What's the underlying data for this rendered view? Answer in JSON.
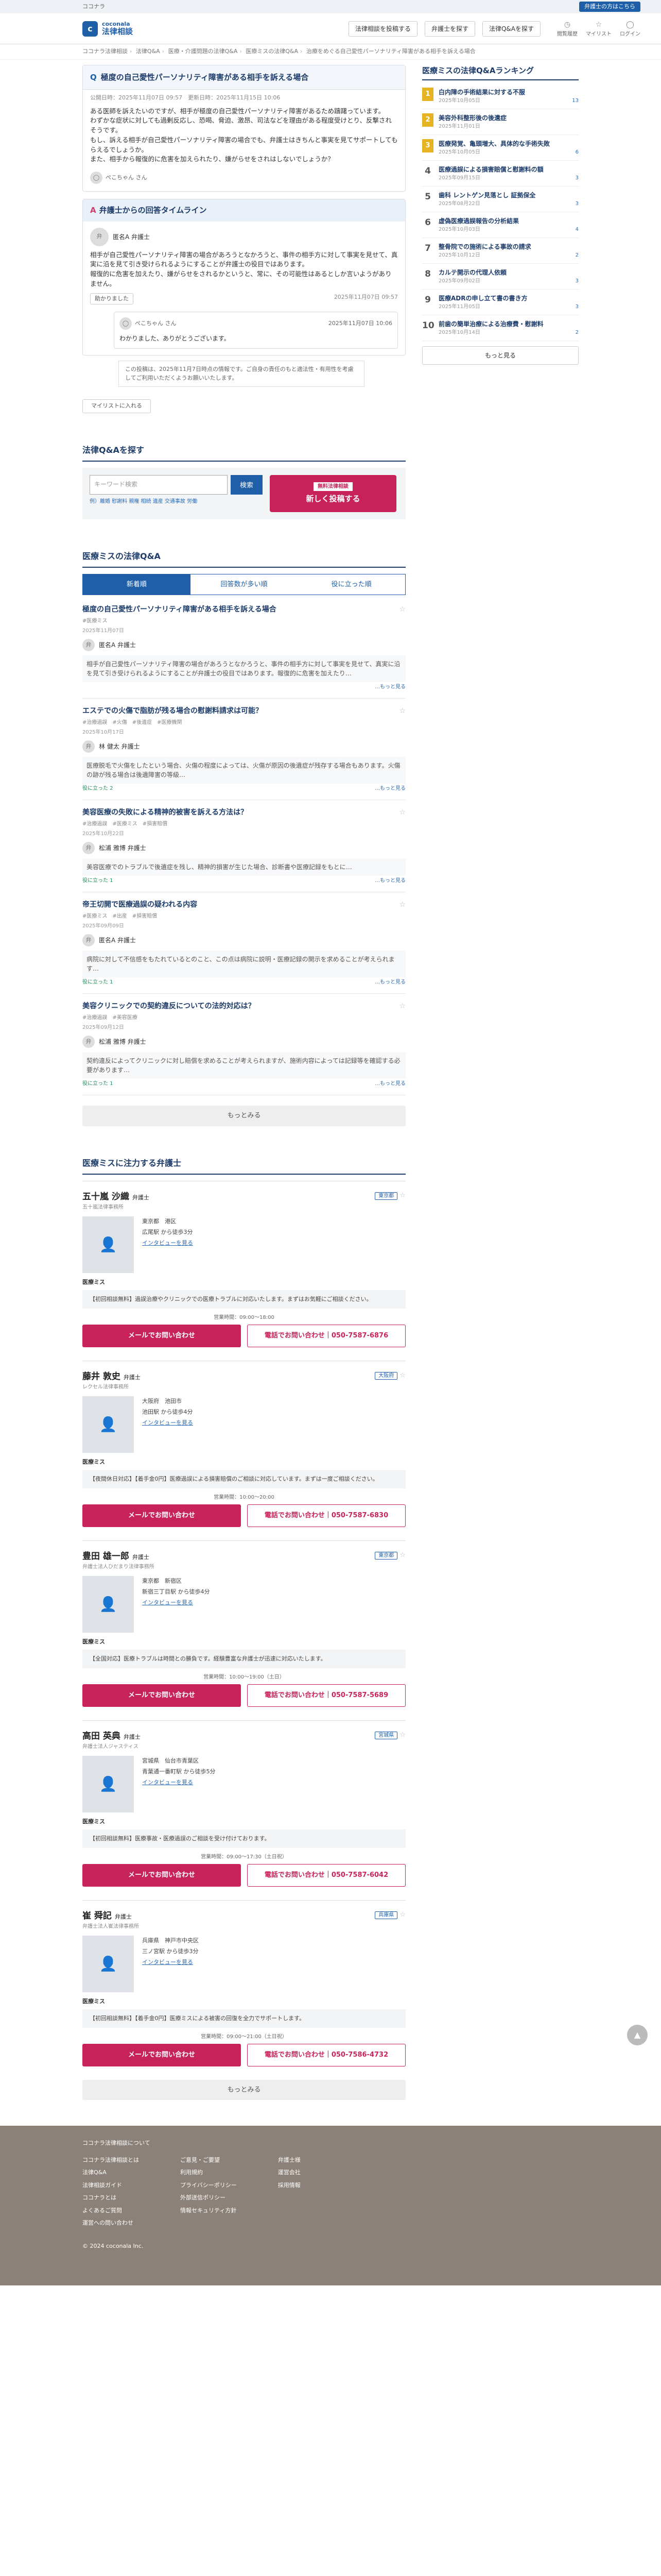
{
  "topline": {
    "tagline": "ココナラ",
    "login": "弁護士の方はこちら"
  },
  "header": {
    "logo_a": "coconala",
    "logo_b": "法律相談",
    "post": "法律相談を投稿する",
    "find": "弁護士を探す",
    "qa": "法律Q&Aを探す",
    "icons": [
      "閲覧履歴",
      "マイリスト",
      "ログイン"
    ]
  },
  "breadcrumb": [
    "ココナラ法律相談",
    "法律Q&A",
    "医療・介護問題の法律Q&A",
    "医療ミスの法律Q&A",
    "治療をめぐる自己愛性パーソナリティ障害がある相手を訴える場合"
  ],
  "question": {
    "title": "極度の自己愛性パーソナリティ障害がある相手を訴える場合",
    "meta": "公開日時：2025年11月07日 09:57　更新日時：2025年11月15日 10:06",
    "body": "ある医師を訴えたいのですが、相手が極度の自己愛性パーソナリティ障害があるため躊躇っています。\nわずかな症状に対しても過剰反応し、恐喝、脅迫、激昂、司法などを理由がある程度受けとり、反撃されそうです。\nもし、訴える相手が自己愛性パーソナリティ障害の場合でも、弁護士はきちんと事実を見てサポートしてもらえるでしょうか。\nまた、相手から報復的に危害を加えられたり、嫌がらせをされはしないでしょうか？",
    "user": "ぺこちゃん さん"
  },
  "answers": {
    "title": "弁護士からの回答タイムライン",
    "lawyer": "匿名A 弁護士",
    "body": "相手が自己愛性パーソナリティ障害の場合があろうとなかろうと、事件の相手方に対して事実を見せて、真実に沿を見て引き受けられるようにすることが弁護士の役目ではあります。\n報復的に危害を加えたり、嫌がらせをされるかというと、常に、その可能性はあるとしか言いようがありません。",
    "thanks": "助かりました",
    "date": "2025年11月07日 09:57",
    "reply_user": "ぺこちゃん さん",
    "reply_date": "2025年11月07日 10:06",
    "reply": "わかりました、ありがとうございます。"
  },
  "note": "この投稿は、2025年11月7日時点の情報です。ご自身の責任のもと適法性・有用性を考慮してご利用いただくようお願いいたします。",
  "mylist": "マイリストに入れる",
  "search": {
    "title": "法律Q&Aを探す",
    "placeholder": "キーワード検索",
    "button": "検索",
    "tags": "例）離婚 慰謝料 親権 相続 遺産 交通事故 労働",
    "post_small": "無料法律相談",
    "post": "新しく投稿する"
  },
  "qa_list": {
    "title": "医療ミスの法律Q&A",
    "tabs": [
      "新着順",
      "回答数が多い順",
      "役に立った順"
    ],
    "items": [
      {
        "title": "極度の自己愛性パーソナリティ障害がある相手を訴える場合",
        "tags": "#医療ミス",
        "date": "2025年11月07日",
        "lawyer": "匿名A 弁護士",
        "excerpt": "相手が自己愛性パーソナリティ障害の場合があろうとなかろうと、事件の相手方に対して事実を見せて、真実に沿を見て引き受けられるようにすることが弁護士の役目ではあります。報復的に危害を加えたり…",
        "helpful": "",
        "more": "…もっと見る"
      },
      {
        "title": "エステでの火傷で脂肪が残る場合の慰謝料請求は可能？",
        "tags": "#治療過誤　#火傷　#後遺症　#医療機関",
        "date": "2025年10月17日",
        "lawyer": "林 健太 弁護士",
        "excerpt": "医療脱毛で火傷をしたという場合、火傷の程度によっては、火傷が原因の後遺症が残存する場合もあります。火傷の跡が残る場合は後遺障害の等級…",
        "helpful": "役に立った 2",
        "more": "…もっと見る"
      },
      {
        "title": "美容医療の失敗による精神的被害を訴える方法は？",
        "tags": "#治療過誤　#医療ミス　#損害賠償",
        "date": "2025年10月22日",
        "lawyer": "松浦 雅博 弁護士",
        "excerpt": "美容医療でのトラブルで後遺症を残し、精神的損害が生じた場合、診断書や医療記録をもとに…",
        "helpful": "役に立った 1",
        "more": "…もっと見る"
      },
      {
        "title": "帝王切開で医療過誤の疑われる内容",
        "tags": "#医療ミス　#出産　#損害賠償",
        "date": "2025年09月09日",
        "lawyer": "匿名A 弁護士",
        "excerpt": "病院に対して不信感をもたれているとのこと、この点は病院に説明・医療記録の開示を求めることが考えられます…",
        "helpful": "役に立った 1",
        "more": "…もっと見る"
      },
      {
        "title": "美容クリニックでの契約違反についての法的対応は？",
        "tags": "#治療過誤　#美容医療",
        "date": "2025年09月12日",
        "lawyer": "松浦 雅博 弁護士",
        "excerpt": "契約違反によってクリニックに対し賠償を求めることが考えられますが、施術内容によっては記録等を確認する必要があります…",
        "helpful": "役に立った 1",
        "more": "…もっと見る"
      }
    ],
    "more": "もっとみる"
  },
  "lawyers": {
    "title": "医療ミスに注力する弁護士",
    "items": [
      {
        "name": "五十嵐 沙織",
        "suffix": "弁護士",
        "firm": "五十嵐法律事務所",
        "pref": "東京都",
        "area": "東京都　港区",
        "station": "広尾駅 から徒歩3分",
        "link": "インタビューを見る",
        "spec": "医療ミス",
        "desc": "【初回相談無料】過誤治療やクリニックでの医療トラブルに対応いたします。まずはお気軽にご相談ください。",
        "hours": "営業時間：09:00〜18:00",
        "mail": "メールでお問い合わせ",
        "tel": "電話でお問い合わせ｜050-7587-6876"
      },
      {
        "name": "藤井 敦史",
        "suffix": "弁護士",
        "firm": "レクセル法律事務所",
        "pref": "大阪府",
        "area": "大阪府　池田市",
        "station": "池田駅 から徒歩4分",
        "link": "インタビューを見る",
        "spec": "医療ミス",
        "desc": "【夜間休日対応】【着手金0円】医療過誤による損害賠償のご相談に対応しています。まずは一度ご相談ください。",
        "hours": "営業時間：10:00〜20:00",
        "mail": "メールでお問い合わせ",
        "tel": "電話でお問い合わせ｜050-7587-6830"
      },
      {
        "name": "豊田 雄一郎",
        "suffix": "弁護士",
        "firm": "弁護士法人ひだまり法律事務所",
        "pref": "東京都",
        "area": "東京都　新宿区",
        "station": "新宿三丁目駅 から徒歩4分",
        "link": "インタビューを見る",
        "spec": "医療ミス",
        "desc": "【全国対応】医療トラブルは時間との勝負です。経験豊富な弁護士が迅速に対応いたします。",
        "hours": "営業時間：10:00〜19:00（土日）",
        "mail": "メールでお問い合わせ",
        "tel": "電話でお問い合わせ｜050-7587-5689"
      },
      {
        "name": "高田 英典",
        "suffix": "弁護士",
        "firm": "弁護士法人ジャスティス",
        "pref": "宮城県",
        "area": "宮城県　仙台市青葉区",
        "station": "青葉通一番町駅 から徒歩5分",
        "link": "インタビューを見る",
        "spec": "医療ミス",
        "desc": "【初回相談無料】医療事故・医療過誤のご相談を受け付けております。",
        "hours": "営業時間：09:00〜17:30（土日祝）",
        "mail": "メールでお問い合わせ",
        "tel": "電話でお問い合わせ｜050-7587-6042"
      },
      {
        "name": "崔 舜記",
        "suffix": "弁護士",
        "firm": "弁護士法人崔法律事務所",
        "pref": "兵庫県",
        "area": "兵庫県　神戸市中央区",
        "station": "三ノ宮駅 から徒歩3分",
        "link": "インタビューを見る",
        "spec": "医療ミス",
        "desc": "【初回相談無料】【着手金0円】医療ミスによる被害の回復を全力でサポートします。",
        "hours": "営業時間：09:00〜21:00（土日祝）",
        "mail": "メールでお問い合わせ",
        "tel": "電話でお問い合わせ｜050-7586-4732"
      }
    ],
    "more": "もっとみる"
  },
  "ranking": {
    "title": "医療ミスの法律Q&Aランキング",
    "more": "もっと見る",
    "items": [
      {
        "t": "白内障の手術結果に対する不服",
        "d": "2025年10月05日",
        "c": "13"
      },
      {
        "t": "美容外科整形後の後遺症",
        "d": "2025年11月01日",
        "c": ""
      },
      {
        "t": "医療発覚、亀頭増大、具体的な手術失敗",
        "d": "2025年10月05日",
        "c": "6"
      },
      {
        "t": "医療過誤による損害賠償と慰謝料の額",
        "d": "2025年09月15日",
        "c": "3"
      },
      {
        "t": "歯科 レントゲン見落とし 証拠保全",
        "d": "2025年08月22日",
        "c": "3"
      },
      {
        "t": "虚偽医療過誤報告の分析結果",
        "d": "2025年10月03日",
        "c": "4"
      },
      {
        "t": "整骨院での施術による事故の請求",
        "d": "2025年10月12日",
        "c": "2"
      },
      {
        "t": "カルテ開示の代理人依頼",
        "d": "2025年09月02日",
        "c": "3"
      },
      {
        "t": "医療ADRの申し立て書の書き方",
        "d": "2025年11月05日",
        "c": "3"
      },
      {
        "t": "前歯の簡単治療による治療費・慰謝料",
        "d": "2025年10月14日",
        "c": "2"
      }
    ]
  },
  "footer": {
    "title": "ココナラ法律相談について",
    "c1": [
      "ココナラ法律相談とは",
      "法律Q&A",
      "法律相談ガイド",
      "ココナラとは",
      "よくあるご質問",
      "運営への問い合わせ"
    ],
    "c2": [
      "ご意見・ご要望",
      "利用規約",
      "プライバシーポリシー",
      "外部送信ポリシー",
      "情報セキュリティ方針"
    ],
    "c3title": "弁護士様",
    "c3": [
      "運営会社",
      "採用情報"
    ],
    "copy": "© 2024 coconala Inc."
  }
}
